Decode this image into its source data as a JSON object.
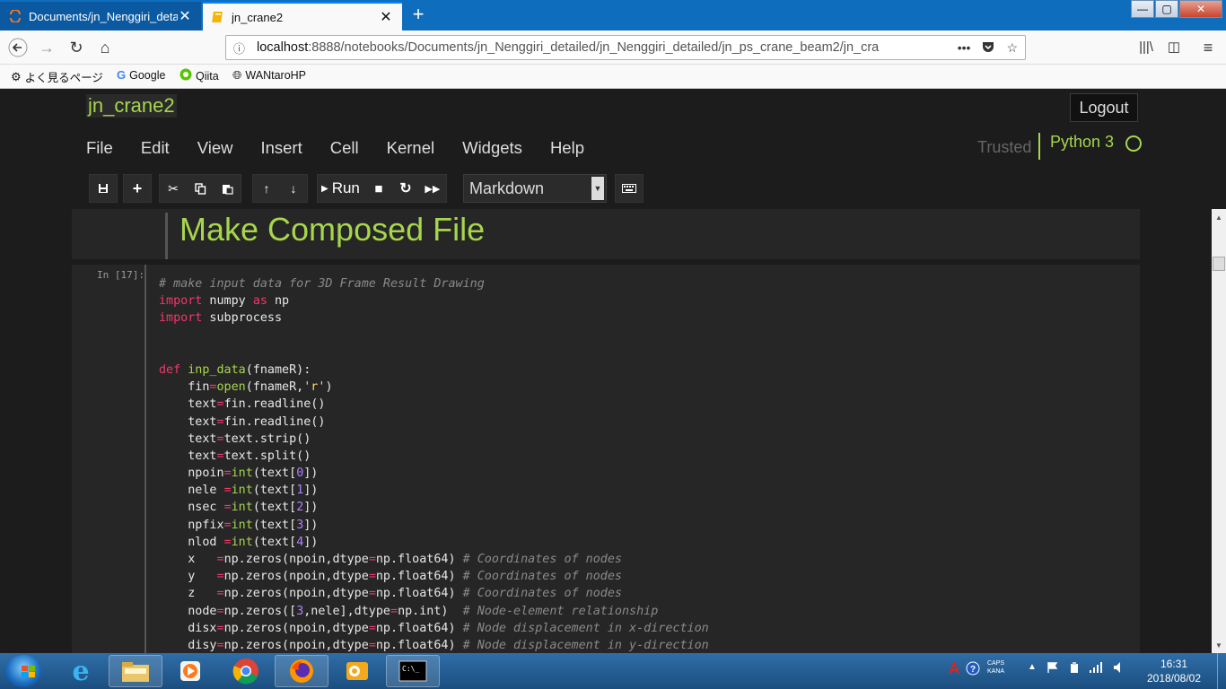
{
  "browser": {
    "tabs": [
      {
        "title": "Documents/jn_Nenggiri_detailed",
        "active": false,
        "close": "✕"
      },
      {
        "title": "jn_crane2",
        "active": true,
        "close": "✕"
      }
    ],
    "new_tab": "+",
    "url_host": "localhost",
    "url_rest": ":8888/notebooks/Documents/jn_Nenggiri_detailed/jn_Nenggiri_detailed/jn_ps_crane_beam2/jn_cra",
    "page_actions": "•••",
    "bookmarks": [
      "よく見るページ",
      "Google",
      "Qiita",
      "WANtaroHP"
    ],
    "window_controls": {
      "min": "—",
      "max": "▢",
      "close": "✕"
    }
  },
  "jupyter": {
    "notebook_name": "jn_crane2",
    "logout_label": "Logout",
    "menu": [
      "File",
      "Edit",
      "View",
      "Insert",
      "Cell",
      "Kernel",
      "Widgets",
      "Help"
    ],
    "trusted_label": "Trusted",
    "kernel_name": "Python 3",
    "toolbar": {
      "run_label": "Run",
      "cell_type": "Markdown"
    }
  },
  "cells": {
    "markdown_heading": "Make Composed File",
    "code_prompt": "In [17]:",
    "code_lines": [
      [
        [
          "cm",
          "# make input data for 3D Frame Result Drawing"
        ]
      ],
      [
        [
          "kw",
          "import"
        ],
        [
          "",
          " numpy "
        ],
        [
          "kw",
          "as"
        ],
        [
          "",
          " np"
        ]
      ],
      [
        [
          "kw",
          "import"
        ],
        [
          "",
          " subprocess"
        ]
      ],
      [],
      [],
      [
        [
          "kw",
          "def"
        ],
        [
          "",
          " "
        ],
        [
          "bi",
          "inp_data"
        ],
        [
          "",
          "(fnameR):"
        ]
      ],
      [
        [
          "",
          "    fin"
        ],
        [
          "kw",
          "="
        ],
        [
          "bi",
          "open"
        ],
        [
          "",
          "(fnameR,"
        ],
        [
          "st",
          "'r'"
        ],
        [
          "",
          ")"
        ]
      ],
      [
        [
          "",
          "    text"
        ],
        [
          "kw",
          "="
        ],
        [
          "",
          "fin.readline()"
        ]
      ],
      [
        [
          "",
          "    text"
        ],
        [
          "kw",
          "="
        ],
        [
          "",
          "fin.readline()"
        ]
      ],
      [
        [
          "",
          "    text"
        ],
        [
          "kw",
          "="
        ],
        [
          "",
          "text.strip()"
        ]
      ],
      [
        [
          "",
          "    text"
        ],
        [
          "kw",
          "="
        ],
        [
          "",
          "text.split()"
        ]
      ],
      [
        [
          "",
          "    npoin"
        ],
        [
          "kw",
          "="
        ],
        [
          "bi",
          "int"
        ],
        [
          "",
          "(text["
        ],
        [
          "nm",
          "0"
        ],
        [
          "",
          "])"
        ]
      ],
      [
        [
          "",
          "    nele "
        ],
        [
          "kw",
          "="
        ],
        [
          "bi",
          "int"
        ],
        [
          "",
          "(text["
        ],
        [
          "nm",
          "1"
        ],
        [
          "",
          "])"
        ]
      ],
      [
        [
          "",
          "    nsec "
        ],
        [
          "kw",
          "="
        ],
        [
          "bi",
          "int"
        ],
        [
          "",
          "(text["
        ],
        [
          "nm",
          "2"
        ],
        [
          "",
          "])"
        ]
      ],
      [
        [
          "",
          "    npfix"
        ],
        [
          "kw",
          "="
        ],
        [
          "bi",
          "int"
        ],
        [
          "",
          "(text["
        ],
        [
          "nm",
          "3"
        ],
        [
          "",
          "])"
        ]
      ],
      [
        [
          "",
          "    nlod "
        ],
        [
          "kw",
          "="
        ],
        [
          "bi",
          "int"
        ],
        [
          "",
          "(text["
        ],
        [
          "nm",
          "4"
        ],
        [
          "",
          "])"
        ]
      ],
      [
        [
          "",
          "    x   "
        ],
        [
          "kw",
          "="
        ],
        [
          "",
          "np.zeros(npoin,dtype"
        ],
        [
          "kw",
          "="
        ],
        [
          "",
          "np.float64) "
        ],
        [
          "cm",
          "# Coordinates of nodes"
        ]
      ],
      [
        [
          "",
          "    y   "
        ],
        [
          "kw",
          "="
        ],
        [
          "",
          "np.zeros(npoin,dtype"
        ],
        [
          "kw",
          "="
        ],
        [
          "",
          "np.float64) "
        ],
        [
          "cm",
          "# Coordinates of nodes"
        ]
      ],
      [
        [
          "",
          "    z   "
        ],
        [
          "kw",
          "="
        ],
        [
          "",
          "np.zeros(npoin,dtype"
        ],
        [
          "kw",
          "="
        ],
        [
          "",
          "np.float64) "
        ],
        [
          "cm",
          "# Coordinates of nodes"
        ]
      ],
      [
        [
          "",
          "    node"
        ],
        [
          "kw",
          "="
        ],
        [
          "",
          "np.zeros(["
        ],
        [
          "nm",
          "3"
        ],
        [
          "",
          ",nele],dtype"
        ],
        [
          "kw",
          "="
        ],
        [
          "",
          "np.int)  "
        ],
        [
          "cm",
          "# Node-element relationship"
        ]
      ],
      [
        [
          "",
          "    disx"
        ],
        [
          "kw",
          "="
        ],
        [
          "",
          "np.zeros(npoin,dtype"
        ],
        [
          "kw",
          "="
        ],
        [
          "",
          "np.float64) "
        ],
        [
          "cm",
          "# Node displacement in x-direction"
        ]
      ],
      [
        [
          "",
          "    disy"
        ],
        [
          "kw",
          "="
        ],
        [
          "",
          "np.zeros(npoin,dtype"
        ],
        [
          "kw",
          "="
        ],
        [
          "",
          "np.float64) "
        ],
        [
          "cm",
          "# Node displacement in y-direction"
        ]
      ]
    ]
  },
  "taskbar": {
    "tray_caps": "CAPS",
    "tray_kana": "KANA",
    "time": "16:31",
    "date": "2018/08/02"
  },
  "colors": {
    "accent_green": "#a6d64c",
    "keyword_pink": "#f0386b",
    "number_purple": "#ae81ff",
    "comment_gray": "#8a8a8a"
  }
}
